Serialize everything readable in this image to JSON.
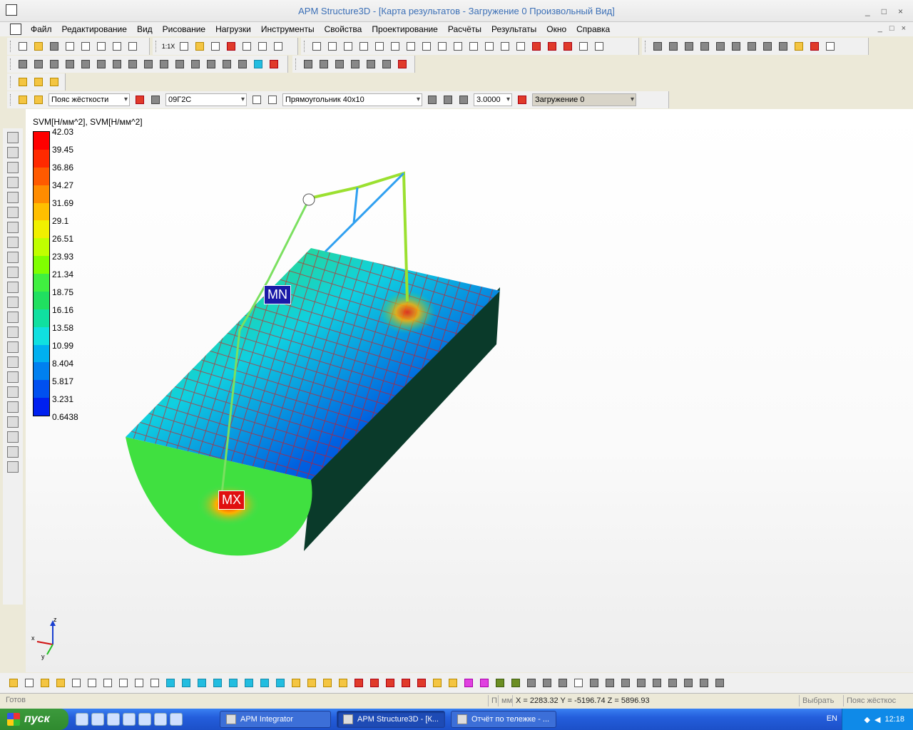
{
  "window": {
    "title": "APM Structure3D - [Карта результатов - Загружение 0 Произвольный Вид]",
    "min": "_",
    "restore": "□",
    "close": "×"
  },
  "menu": [
    "Файл",
    "Редактирование",
    "Вид",
    "Рисование",
    "Нагрузки",
    "Инструменты",
    "Свойства",
    "Проектирование",
    "Расчёты",
    "Результаты",
    "Окно",
    "Справка"
  ],
  "toolbar": {
    "zoom_label": "1:1X",
    "combos": {
      "type": "Пояс жёсткости",
      "material": "09Г2С",
      "section": "Прямоугольник 40x10",
      "value": "3.0000",
      "loading": "Загружение 0"
    }
  },
  "legend": {
    "title": "SVM[Н/мм^2], SVM[Н/мм^2]",
    "values": [
      "42.03",
      "39.45",
      "36.86",
      "34.27",
      "31.69",
      "29.1",
      "26.51",
      "23.93",
      "21.34",
      "18.75",
      "16.16",
      "13.58",
      "10.99",
      "8.404",
      "5.817",
      "3.231",
      "0.6438"
    ],
    "colors": [
      "#ff0000",
      "#ff2a00",
      "#ff5a00",
      "#ff8c00",
      "#ffbf00",
      "#f0f000",
      "#c0ff00",
      "#80ff00",
      "#40f040",
      "#20e060",
      "#10e0a0",
      "#10e0e0",
      "#00b0f0",
      "#0080f0",
      "#0050f0",
      "#0020f0"
    ]
  },
  "markers": {
    "min": "MN",
    "max": "MX"
  },
  "axes": {
    "x": "x",
    "y": "y",
    "z": "z"
  },
  "status": {
    "ready": "Готов",
    "units": "мм",
    "coords": "X = 2283.32 Y = -5196.74 Z = 5896.93",
    "select": "Выбрать",
    "mode": "Пояс жёсткос"
  },
  "taskbar": {
    "start": "пуск",
    "tasks": [
      "APM Integrator",
      "APM Structure3D - [К...",
      "Отчёт по тележке - ..."
    ],
    "lang": "EN",
    "clock": "12:18"
  }
}
